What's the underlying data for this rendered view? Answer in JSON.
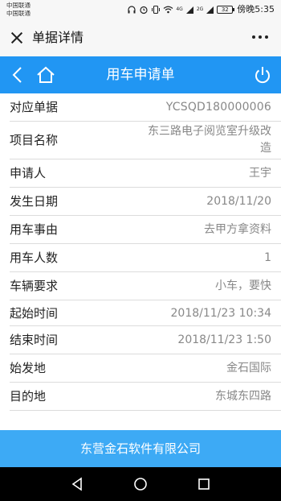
{
  "status_bar": {
    "carrier_1": "中国联通",
    "carrier_2": "中国联通",
    "signal_4g": "4G",
    "signal_2g": "2G",
    "battery": "32",
    "time": "傍晚5:35",
    "icons": [
      "headset-icon",
      "alarm-icon",
      "vibrate-icon",
      "wifi-icon",
      "signal-4g-icon",
      "signal-2g-icon",
      "battery-icon"
    ]
  },
  "header": {
    "title": "单据详情",
    "close_icon": "close-icon",
    "more_icon": "more-icon"
  },
  "nav": {
    "title": "用车申请单",
    "back_icon": "chevron-left-icon",
    "home_icon": "home-icon",
    "power_icon": "power-icon",
    "color": "#2196f3"
  },
  "form": {
    "rows": [
      {
        "label": "对应单据",
        "value": "YCSQD180000006"
      },
      {
        "label": "项目名称",
        "value": "东三路电子阅览室升级改造"
      },
      {
        "label": "申请人",
        "value": "王宇"
      },
      {
        "label": "发生日期",
        "value": "2018/11/20"
      },
      {
        "label": "用车事由",
        "value": "去甲方拿资料"
      },
      {
        "label": "用车人数",
        "value": "1"
      },
      {
        "label": "车辆要求",
        "value": "小车，要快"
      },
      {
        "label": "起始时间",
        "value": "2018/11/23 10:34"
      },
      {
        "label": "结束时间",
        "value": "2018/11/23 1:50"
      },
      {
        "label": "始发地",
        "value": "金石国际"
      },
      {
        "label": "目的地",
        "value": "东城东四路"
      }
    ]
  },
  "footer": {
    "text": "东营金石软件有限公司",
    "color": "#3daaf5"
  },
  "system_nav": {
    "back_icon": "triangle-back-icon",
    "home_icon": "circle-home-icon",
    "recent_icon": "square-recent-icon"
  }
}
